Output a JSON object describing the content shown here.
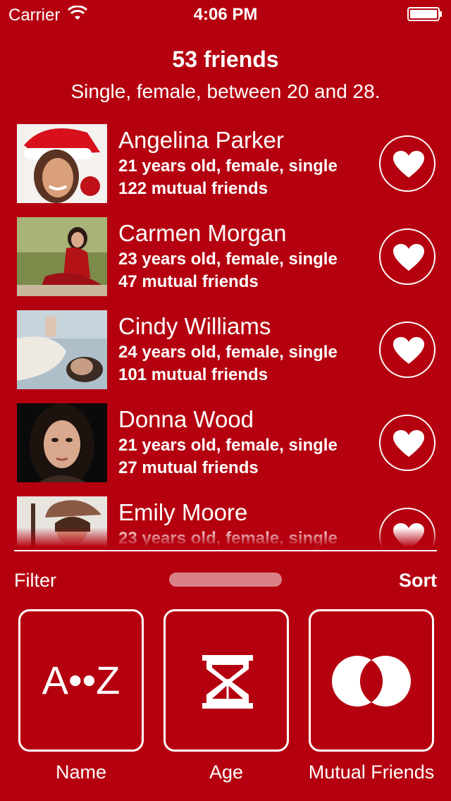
{
  "status_bar": {
    "carrier": "Carrier",
    "time": "4:06 PM",
    "wifi_icon": "wifi-icon",
    "battery_icon": "battery-icon"
  },
  "header": {
    "title": "53 friends",
    "subtitle": "Single, female, between 20 and 28."
  },
  "friends": [
    {
      "name": "Angelina Parker",
      "details": "21 years old, female, single",
      "mutual": "122 mutual friends",
      "icon": "heart-icon"
    },
    {
      "name": "Carmen Morgan",
      "details": "23 years old, female, single",
      "mutual": "47 mutual friends",
      "icon": "heart-icon"
    },
    {
      "name": "Cindy Williams",
      "details": "24 years old, female, single",
      "mutual": "101 mutual friends",
      "icon": "heart-icon"
    },
    {
      "name": "Donna Wood",
      "details": "21 years old, female, single",
      "mutual": "27 mutual friends",
      "icon": "heart-icon"
    },
    {
      "name": "Emily Moore",
      "details": "23 years old, female, single",
      "mutual": "",
      "icon": "heart-icon"
    }
  ],
  "controls": {
    "filter_label": "Filter",
    "sort_label": "Sort"
  },
  "sort_options": [
    {
      "label": "Name",
      "icon_text": "A••Z",
      "icon": "alphabetical-icon"
    },
    {
      "label": "Age",
      "icon": "hourglass-icon"
    },
    {
      "label": "Mutual Friends",
      "icon": "overlapping-circles-icon"
    }
  ],
  "colors": {
    "background": "#b5000f",
    "foreground": "#ffffff"
  }
}
